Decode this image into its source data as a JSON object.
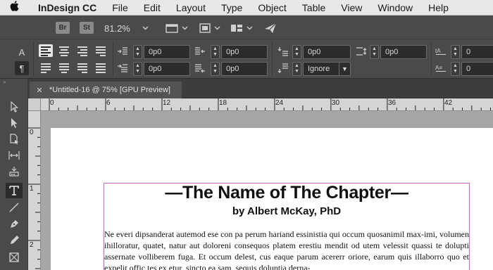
{
  "menubar": {
    "app_name": "InDesign CC",
    "items": [
      "File",
      "Edit",
      "Layout",
      "Type",
      "Object",
      "Table",
      "View",
      "Window",
      "Help"
    ]
  },
  "app_bar": {
    "bridge_label": "Br",
    "stock_label": "St",
    "zoom": "81.2%"
  },
  "control_panel": {
    "char_mode_label": "A",
    "para_mode_label": "¶",
    "left_indent": "0p0",
    "right_indent": "0p0",
    "first_line_indent": "0p0",
    "last_line_indent": "0p0",
    "space_before": "0p0",
    "space_after": "0p0",
    "drop_cap_lines": "0",
    "drop_cap_chars": "0",
    "grid_align": "Ignore"
  },
  "document_tab": {
    "close_label": "✕",
    "title": "*Untitled-16 @ 75% [GPU Preview]"
  },
  "ruler": {
    "h_labels": [
      "0",
      "6",
      "12",
      "18",
      "24",
      "30",
      "36",
      "42"
    ],
    "v_labels": [
      "0",
      "1",
      "2"
    ]
  },
  "document": {
    "chapter_title": "—The Name of The Chapter—",
    "byline": "by Albert McKay, PhD",
    "body": "Ne everi dipsanderat autemod ese con pa perum hariand essinistia qui occum quosanimil max-imi, volumen ihilloratur, quatet, natur aut doloreni consequos platem erestiu mendit od utem velessit quassi te dolupti assernate volliberem fuga. Et occum delest, cus eaque parum acererr oriore, earum quis illaborro quo et expelit offic tes ex etur, sincto ea sam, sequis doluntia derna-"
  },
  "colors": {
    "frame_border": "#d066d0",
    "ui_panel": "#4a4a4a",
    "pasteboard": "#a6a6a6"
  }
}
